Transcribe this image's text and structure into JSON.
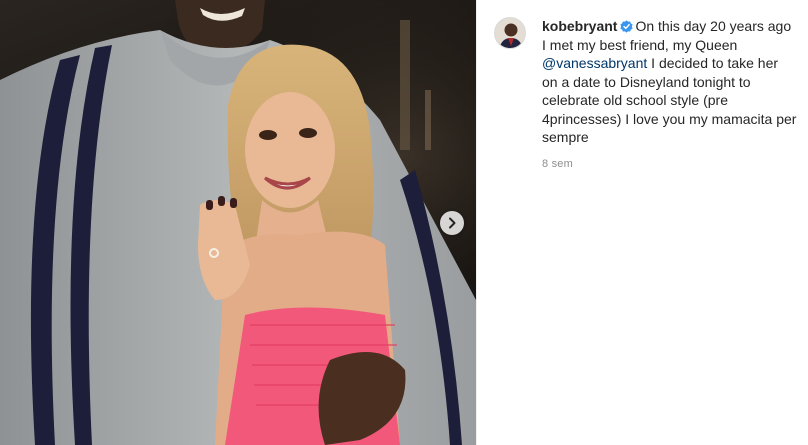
{
  "post": {
    "username": "kobebryant",
    "verified_icon": "verified-badge-icon",
    "caption_before_mention": "On this day 20 years ago I met my best friend, my Queen ",
    "mention": "@vanessabryant",
    "caption_after_mention": " I decided to take her on a date to Disneyland tonight to celebrate old school style (pre 4princesses) I love you my mamacita per sempre",
    "timestamp": "8 sem"
  },
  "media": {
    "next_icon": "chevron-right-icon"
  },
  "colors": {
    "verified": "#3897f0",
    "mention": "#00376b",
    "text": "#262626",
    "muted": "#8e8e8e"
  }
}
